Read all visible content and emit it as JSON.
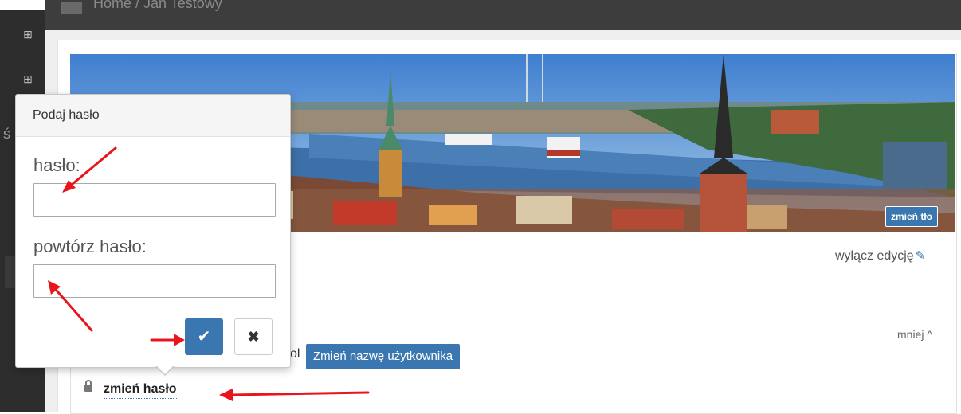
{
  "breadcrumb": {
    "text": "Home / Jan Testowy"
  },
  "sidebar": {
    "icon_names": [
      "grid-icon",
      "grid-icon"
    ],
    "letter": "ś"
  },
  "banner": {
    "change_bg_label": "zmień tło"
  },
  "profile": {
    "disable_edit_label": "wyłącz edycję",
    "disable_edit_icon": "edit-icon",
    "less_label": "mniej ^",
    "username_fragment": "ol",
    "rename_button_label": "Zmień nazwę użytkownika",
    "change_password_label": "zmień hasło",
    "lock_icon": "lock-icon"
  },
  "popover": {
    "title": "Podaj hasło",
    "password_label": "hasło:",
    "password_value": "",
    "repeat_label": "powtórz hasło:",
    "repeat_value": "",
    "confirm_icon": "✔",
    "cancel_icon": "✖"
  },
  "colors": {
    "accent": "#3a76b0",
    "annotation_arrow": "#e8161c",
    "sidebar": "#2d2d2d",
    "breadcrumb_bar": "#3d3d3d"
  }
}
